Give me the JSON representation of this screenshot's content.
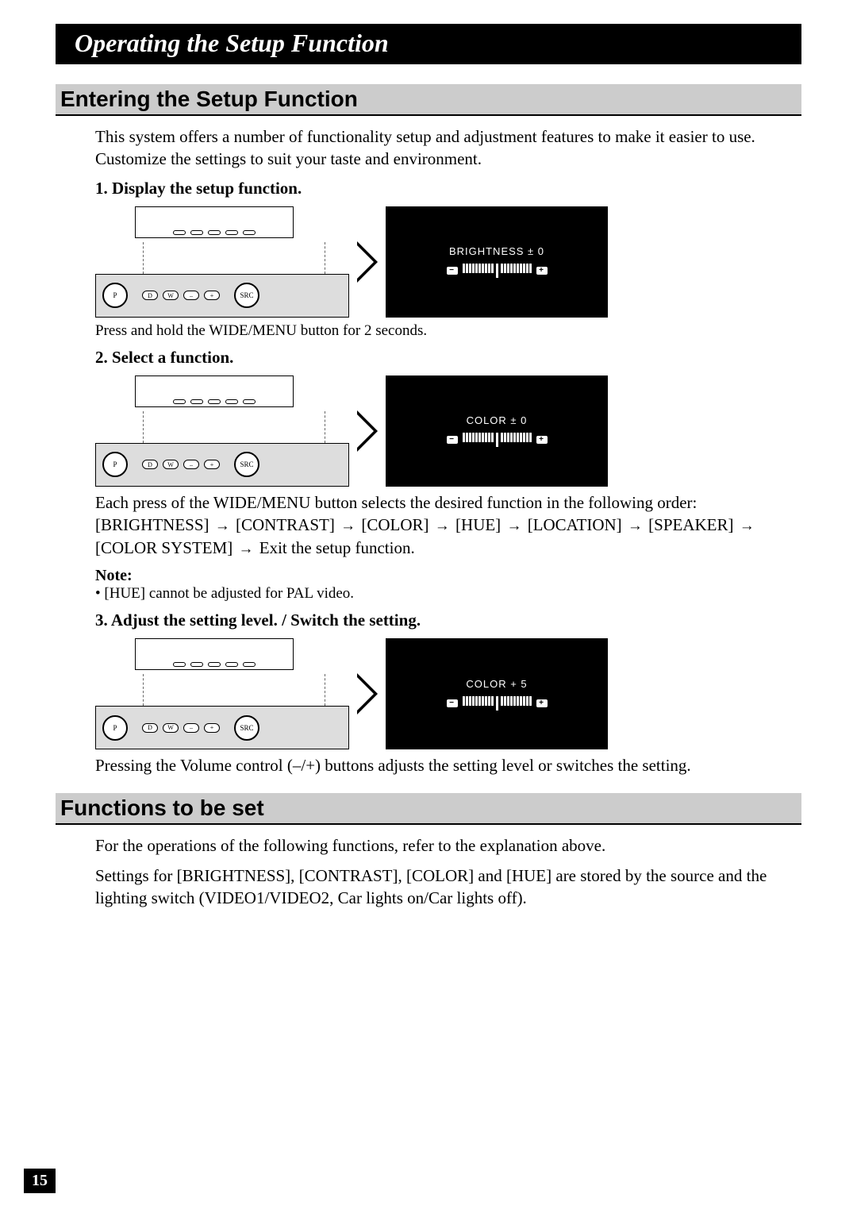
{
  "title": "Operating the Setup Function",
  "section1": {
    "heading": "Entering the Setup Function",
    "intro": "This system offers a number of functionality setup and adjustment features to make it easier to use. Customize the settings to suit your taste and environment.",
    "step1": {
      "heading": "1.  Display the setup function.",
      "screen_label": "BRIGHTNESS  ± 0",
      "caption": "Press and hold the WIDE/MENU button for 2 seconds."
    },
    "step2": {
      "heading": "2.  Select a function.",
      "screen_label": "COLOR   ± 0",
      "desc_intro": "Each press of the WIDE/MENU button selects the desired function in the following order:",
      "seq": [
        "[BRIGHTNESS]",
        "[CONTRAST]",
        "[COLOR]",
        "[HUE]",
        "[LOCATION]",
        "[SPEAKER]",
        "[COLOR SYSTEM]"
      ],
      "seq_exit": "Exit the setup function.",
      "note_label": "Note:",
      "note_text": "•  [HUE] cannot be adjusted for PAL video."
    },
    "step3": {
      "heading": "3.  Adjust the setting level. / Switch the setting.",
      "screen_label": "COLOR   + 5",
      "desc": "Pressing the Volume control (–/+) buttons adjusts the setting level or switches the setting."
    }
  },
  "section2": {
    "heading": "Functions to be set",
    "text1": "For the operations of the following functions, refer to the explanation above.",
    "text2": "Settings for [BRIGHTNESS], [CONTRAST], [COLOR] and [HUE] are stored by the source and the lighting switch (VIDEO1/VIDEO2, Car lights on/Car lights off)."
  },
  "buttons": {
    "src": "SRC",
    "p": "P",
    "d": "D",
    "w": "W",
    "minus": "–",
    "plus": "+"
  },
  "page_number": "15"
}
